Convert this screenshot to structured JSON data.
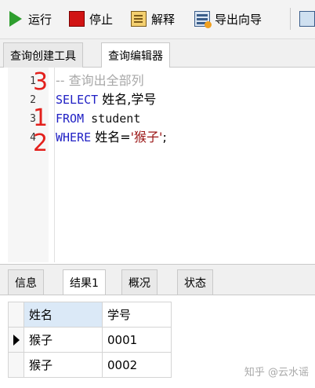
{
  "toolbar": {
    "run_label": "运行",
    "stop_label": "停止",
    "explain_label": "解释",
    "export_label": "导出向导"
  },
  "tabs": [
    {
      "label": "查询创建工具",
      "active": false
    },
    {
      "label": "查询编辑器",
      "active": true
    }
  ],
  "editor": {
    "lines": [
      {
        "number": "1",
        "comment": "-- 查询出全部列"
      },
      {
        "number": "2",
        "keyword": "SELECT",
        "rest": " 姓名,学号"
      },
      {
        "number": "3",
        "keyword": "FROM",
        "rest": " student"
      },
      {
        "number": "4",
        "keyword": "WHERE",
        "pre": " 姓名=",
        "string": "'猴子'",
        "post": ";"
      }
    ],
    "annotations": [
      "3",
      "1",
      "2"
    ]
  },
  "result_tabs": [
    {
      "label": "信息",
      "active": false
    },
    {
      "label": "结果1",
      "active": true
    },
    {
      "label": "概况",
      "active": false
    },
    {
      "label": "状态",
      "active": false
    }
  ],
  "result_table": {
    "columns": [
      "姓名",
      "学号"
    ],
    "rows": [
      [
        "猴子",
        "0001"
      ],
      [
        "猴子",
        "0002"
      ]
    ]
  },
  "watermark": "知乎 @云水谣",
  "colors": {
    "keyword": "#1f1fc4",
    "comment": "#a8a8a8",
    "string": "#9b1616",
    "annotation": "#e3201c",
    "run_icon": "#2e9e2e",
    "stop_icon": "#d11414"
  },
  "icons": {
    "run": "play-icon",
    "stop": "stop-icon",
    "explain": "explain-icon",
    "export": "export-wizard-icon"
  }
}
